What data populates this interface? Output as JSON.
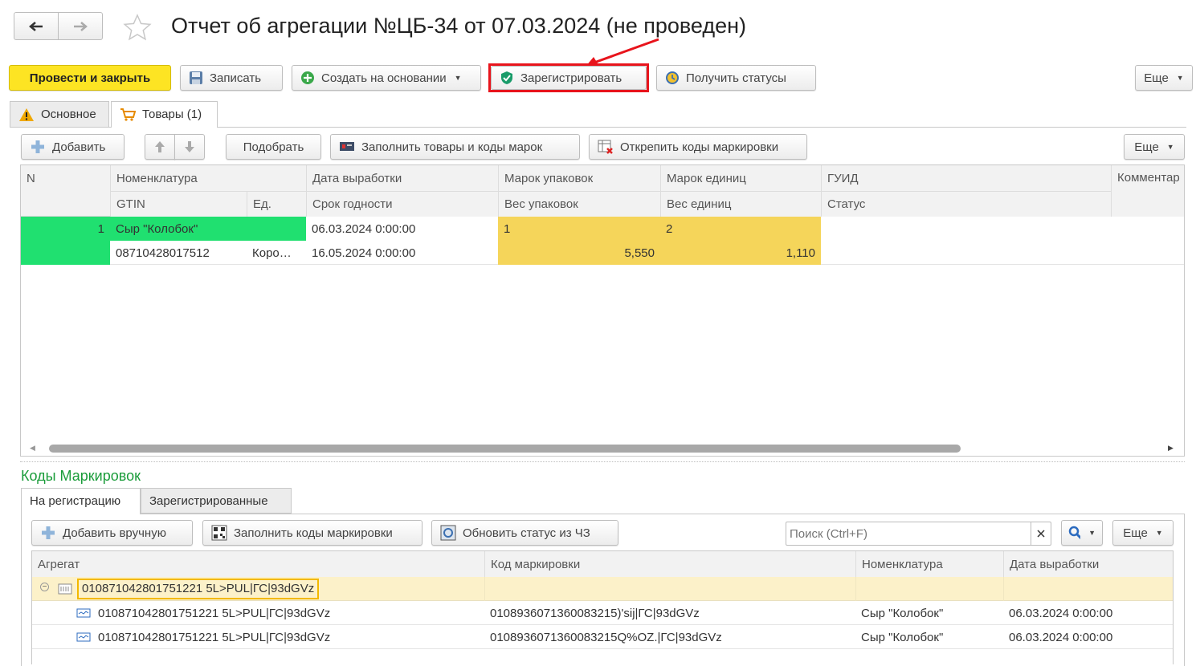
{
  "title": "Отчет об агрегации №ЦБ-34 от 07.03.2024 (не проведен)",
  "toolbar": {
    "post_close": "Провести и закрыть",
    "save": "Записать",
    "create_based": "Создать на основании",
    "register": "Зарегистрировать",
    "get_statuses": "Получить статусы",
    "more": "Еще"
  },
  "tabs": {
    "main": "Основное",
    "goods": "Товары (1)"
  },
  "goods_toolbar": {
    "add": "Добавить",
    "pick": "Подобрать",
    "fill": "Заполнить товары и коды марок",
    "detach": "Открепить коды маркировки",
    "more": "Еще"
  },
  "goods_table": {
    "headers_row1": [
      "N",
      "Номенклатура",
      "Дата выработки",
      "Марок упаковок",
      "Марок единиц",
      "ГУИД",
      "Комментар"
    ],
    "headers_row2": [
      "GTIN",
      "Ед.",
      "Срок годности",
      "Вес упаковок",
      "Вес единиц",
      "Статус"
    ],
    "row": {
      "n": "1",
      "name": "Сыр \"Колобок\"",
      "gtin": "08710428017512",
      "unit": "Коро…",
      "prod_date": "06.03.2024 0:00:00",
      "exp_date": "16.05.2024 0:00:00",
      "pack_marks": "1",
      "unit_marks": "2",
      "pack_weight": "5,550",
      "unit_weight": "1,110"
    }
  },
  "codes_section": {
    "title": "Коды Маркировок",
    "tabs": [
      "На регистрацию",
      "Зарегистрированные"
    ],
    "toolbar": {
      "add_manual": "Добавить вручную",
      "fill_codes": "Заполнить коды маркировки",
      "update_status": "Обновить статус из ЧЗ",
      "search_placeholder": "Поиск (Ctrl+F)",
      "more": "Еще"
    },
    "headers": [
      "Агрегат",
      "Код маркировки",
      "Номенклатура",
      "Дата выработки"
    ],
    "group": "010871042801751221 5L>PUL|ГС|93dGVz",
    "rows": [
      {
        "aggregate": "010871042801751221 5L>PUL|ГС|93dGVz",
        "code": "0108936071360083215)'sij|ГС|93dGVz",
        "name": "Сыр \"Колобок\"",
        "date": "06.03.2024 0:00:00"
      },
      {
        "aggregate": "010871042801751221 5L>PUL|ГС|93dGVz",
        "code": "0108936071360083215Q%OZ.|ГС|93dGVz",
        "name": "Сыр \"Колобок\"",
        "date": "06.03.2024 0:00:00"
      }
    ]
  },
  "colors": {
    "primary_button": "#fde423",
    "green_cell": "#20e070",
    "yellow_cell": "#f5d55a",
    "highlight": "#e8141c",
    "section_title": "#1a9c3a"
  }
}
